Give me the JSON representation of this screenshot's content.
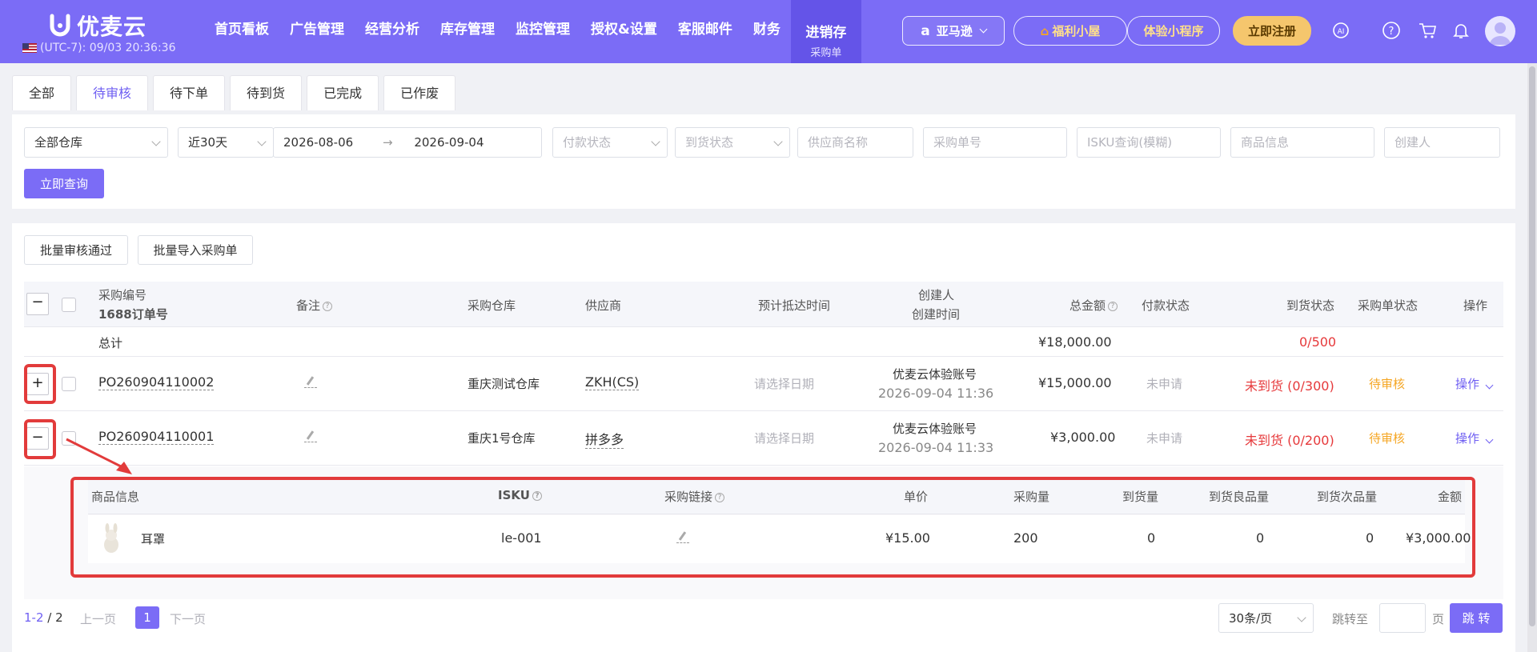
{
  "brand": {
    "name": "优麦云",
    "timezone": "(UTC-7): 09/03 20:36:36"
  },
  "nav": [
    {
      "label": "首页看板"
    },
    {
      "label": "广告管理"
    },
    {
      "label": "经营分析"
    },
    {
      "label": "库存管理"
    },
    {
      "label": "监控管理"
    },
    {
      "label": "授权&设置"
    },
    {
      "label": "客服邮件"
    },
    {
      "label": "财务"
    }
  ],
  "nav_active": {
    "label": "进销存",
    "sub": "采购单"
  },
  "header_buttons": {
    "marketplace": "亚马逊",
    "fuli": "福利小屋",
    "miniapp": "体验小程序",
    "register": "立即注册"
  },
  "tabs": [
    {
      "label": "全部"
    },
    {
      "label": "待审核"
    },
    {
      "label": "待下单"
    },
    {
      "label": "待到货"
    },
    {
      "label": "已完成"
    },
    {
      "label": "已作废"
    }
  ],
  "filters": {
    "warehouse": "全部仓库",
    "range": "近30天",
    "date_start": "2026-08-06",
    "date_end": "2026-09-04",
    "pay_status": "付款状态",
    "arrival_status": "到货状态",
    "supplier": "供应商名称",
    "po_no": "采购单号",
    "isku": "ISKU查询(模糊)",
    "product": "商品信息",
    "creator": "创建人",
    "query_btn": "立即查询"
  },
  "actions": {
    "batch_approve": "批量审核通过",
    "batch_import": "批量导入采购单"
  },
  "columns": {
    "po_no": "采购编号",
    "order_1688": "1688订单号",
    "remark": "备注",
    "warehouse": "采购仓库",
    "supplier": "供应商",
    "eta": "预计抵达时间",
    "creator": "创建人",
    "created_at": "创建时间",
    "total": "总金额",
    "pay_status": "付款状态",
    "arrival": "到货状态",
    "po_status": "采购单状态",
    "ops": "操作"
  },
  "summary": {
    "label": "总计",
    "total": "¥18,000.00",
    "arrival": "0/500"
  },
  "rows": [
    {
      "toggle": "+",
      "po_no": "PO260904110002",
      "warehouse": "重庆测试仓库",
      "supplier": "ZKH(CS)",
      "eta": "请选择日期",
      "creator": "优麦云体验账号",
      "created_at": "2026-09-04 11:36",
      "total": "¥15,000.00",
      "pay_status": "未申请",
      "arrival": "未到货 (0/300)",
      "po_status": "待审核",
      "ops": "操作"
    },
    {
      "toggle": "−",
      "po_no": "PO260904110001",
      "warehouse": "重庆1号仓库",
      "supplier": "拼多多",
      "eta": "请选择日期",
      "creator": "优麦云体验账号",
      "created_at": "2026-09-04 11:33",
      "total": "¥3,000.00",
      "pay_status": "未申请",
      "arrival": "未到货 (0/200)",
      "po_status": "待审核",
      "ops": "操作"
    }
  ],
  "sub_columns": {
    "product": "商品信息",
    "isku": "ISKU",
    "link": "采购链接",
    "price": "单价",
    "qty": "采购量",
    "arrived": "到货量",
    "good": "到货良品量",
    "bad": "到货次品量",
    "amount": "金额"
  },
  "sub_rows": [
    {
      "product": "耳罩",
      "isku": "le-001",
      "price": "¥15.00",
      "qty": "200",
      "arrived": "0",
      "good": "0",
      "bad": "0",
      "amount": "¥3,000.00"
    }
  ],
  "pagination": {
    "range": "1-2",
    "sep": "/",
    "total": "2",
    "prev": "上一页",
    "page": "1",
    "next": "下一页",
    "page_size": "30条/页",
    "goto_label": "跳转至",
    "page_unit": "页",
    "go_btn": "跳 转"
  },
  "colors": {
    "accent": "#7b6cf6",
    "red": "#e6393b",
    "orange": "#f5a623",
    "highlight": "#e23b3b"
  }
}
